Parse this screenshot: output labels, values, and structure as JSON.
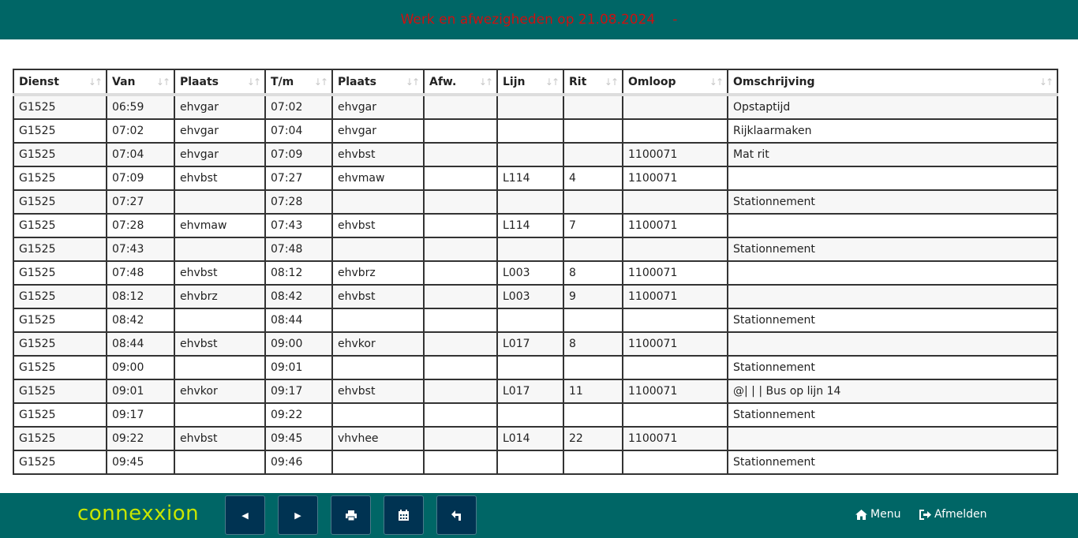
{
  "header": {
    "title": "Werk en afwezigheden op 21.08.2024",
    "dash": "-"
  },
  "table": {
    "columns": [
      "Dienst",
      "Van",
      "Plaats",
      "T/m",
      "Plaats",
      "Afw.",
      "Lijn",
      "Rit",
      "Omloop",
      "Omschrijving"
    ],
    "rows": [
      [
        "G1525",
        "06:59",
        "ehvgar",
        "07:02",
        "ehvgar",
        "",
        "",
        "",
        "",
        "Opstaptijd"
      ],
      [
        "G1525",
        "07:02",
        "ehvgar",
        "07:04",
        "ehvgar",
        "",
        "",
        "",
        "",
        "Rijklaarmaken"
      ],
      [
        "G1525",
        "07:04",
        "ehvgar",
        "07:09",
        "ehvbst",
        "",
        "",
        "",
        "1100071",
        "Mat rit"
      ],
      [
        "G1525",
        "07:09",
        "ehvbst",
        "07:27",
        "ehvmaw",
        "",
        "L114",
        "4",
        "1100071",
        ""
      ],
      [
        "G1525",
        "07:27",
        "",
        "07:28",
        "",
        "",
        "",
        "",
        "",
        "Stationnement"
      ],
      [
        "G1525",
        "07:28",
        "ehvmaw",
        "07:43",
        "ehvbst",
        "",
        "L114",
        "7",
        "1100071",
        ""
      ],
      [
        "G1525",
        "07:43",
        "",
        "07:48",
        "",
        "",
        "",
        "",
        "",
        "Stationnement"
      ],
      [
        "G1525",
        "07:48",
        "ehvbst",
        "08:12",
        "ehvbrz",
        "",
        "L003",
        "8",
        "1100071",
        ""
      ],
      [
        "G1525",
        "08:12",
        "ehvbrz",
        "08:42",
        "ehvbst",
        "",
        "L003",
        "9",
        "1100071",
        ""
      ],
      [
        "G1525",
        "08:42",
        "",
        "08:44",
        "",
        "",
        "",
        "",
        "",
        "Stationnement"
      ],
      [
        "G1525",
        "08:44",
        "ehvbst",
        "09:00",
        "ehvkor",
        "",
        "L017",
        "8",
        "1100071",
        ""
      ],
      [
        "G1525",
        "09:00",
        "",
        "09:01",
        "",
        "",
        "",
        "",
        "",
        "Stationnement"
      ],
      [
        "G1525",
        "09:01",
        "ehvkor",
        "09:17",
        "ehvbst",
        "",
        "L017",
        "11",
        "1100071",
        "@| | | Bus op lijn 14"
      ],
      [
        "G1525",
        "09:17",
        "",
        "09:22",
        "",
        "",
        "",
        "",
        "",
        "Stationnement"
      ],
      [
        "G1525",
        "09:22",
        "ehvbst",
        "09:45",
        "vhvhee",
        "",
        "L014",
        "22",
        "1100071",
        ""
      ],
      [
        "G1525",
        "09:45",
        "",
        "09:46",
        "",
        "",
        "",
        "",
        "",
        "Stationnement"
      ]
    ]
  },
  "footer": {
    "logo": "connexxion",
    "buttons": [
      {
        "name": "prev-button",
        "icon": "caret-left-icon",
        "glyph": "◀"
      },
      {
        "name": "next-button",
        "icon": "caret-right-icon",
        "glyph": "▶"
      },
      {
        "name": "print-button",
        "icon": "print-icon",
        "glyph": "🖶"
      },
      {
        "name": "calendar-button",
        "icon": "calendar-icon",
        "glyph": "▦"
      },
      {
        "name": "back-button",
        "icon": "reply-icon",
        "glyph": "↰"
      }
    ],
    "menu_label": "Menu",
    "logout_label": "Afmelden"
  },
  "colors": {
    "bar": "#006666",
    "title": "#cc1111",
    "logo": "#c8e600",
    "button": "#003352"
  }
}
